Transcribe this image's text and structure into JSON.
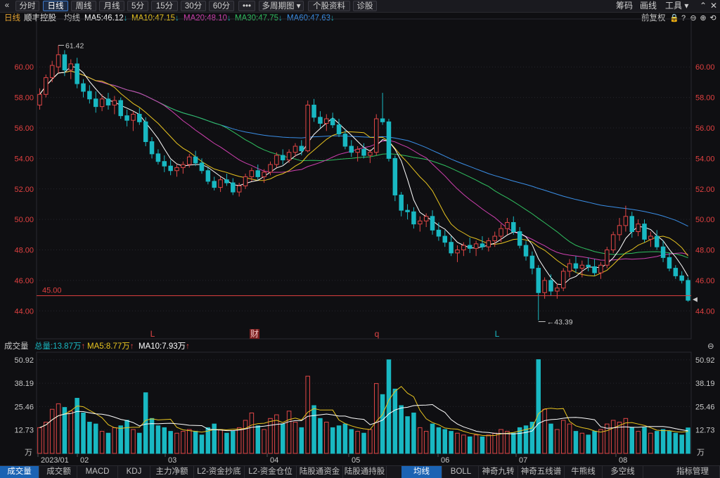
{
  "toolbar": {
    "back_glyph": "«",
    "periods": [
      "分时",
      "日线",
      "周线",
      "月线",
      "5分",
      "15分",
      "30分",
      "60分",
      "•••",
      "多周期图 ▾",
      "个股资料",
      "诊股"
    ],
    "active_index": 1,
    "right": [
      "筹码",
      "画线",
      "工具 ▾"
    ]
  },
  "info": {
    "period": "日线",
    "name": "顺丰控股",
    "label": "均线",
    "ma5": "MA5:46.12",
    "ma10": "MA10:47.15",
    "ma20": "MA20:48.10",
    "ma30": "MA30:47.75",
    "ma60": "MA60:47.63",
    "adjust": "前复权"
  },
  "colors": {
    "up": "#e04646",
    "down": "#19b8c2",
    "ma5": "#ffffff",
    "ma10": "#e8c420",
    "ma20": "#d040b0",
    "ma30": "#30c060",
    "ma60": "#3a8ee6",
    "grid": "#2a2a30",
    "axis": "#e04040"
  },
  "price_axis": {
    "ticks": [
      "60.00",
      "58.00",
      "56.00",
      "54.00",
      "52.00",
      "50.00",
      "48.00",
      "46.00",
      "44.00"
    ],
    "values": [
      60,
      58,
      56,
      54,
      52,
      50,
      48,
      46,
      44
    ]
  },
  "annotations": {
    "high": "61.42",
    "low": "43.39",
    "hline": "45.00",
    "markers": [
      "L",
      "财",
      "q",
      "L"
    ]
  },
  "volume": {
    "title": "成交量",
    "total": "总量:13.87万",
    "ma5": "MA5:8.77万",
    "ma10": "MA10:7.93万",
    "ticks": [
      "50.92",
      "38.19",
      "25.46",
      "12.73",
      "万"
    ],
    "tick_values": [
      50.92,
      38.19,
      25.46,
      12.73
    ]
  },
  "dates": [
    "2023/01",
    "02",
    "03",
    "04",
    "05",
    "06",
    "07",
    "08"
  ],
  "bottom_tabs": [
    "成交量",
    "成交额",
    "MACD",
    "KDJ",
    "主力净额",
    "L2-资金抄底",
    "L2-资金仓位",
    "陆股通资金",
    "陆股通持股",
    "均线",
    "BOLL",
    "神奇九转",
    "神奇五线谱",
    "牛熊线",
    "多空线",
    "指标管理"
  ],
  "bottom_active": [
    0,
    9
  ],
  "chart_data": {
    "type": "candlestick",
    "price_range": [
      43,
      62.5
    ],
    "volume_range": [
      0,
      52
    ],
    "bars": [
      [
        57.5,
        58.6,
        57.2,
        58.2,
        14
      ],
      [
        58.2,
        59.5,
        58,
        59.3,
        17
      ],
      [
        59.3,
        60.4,
        59,
        60.1,
        24
      ],
      [
        60.0,
        61.42,
        59.6,
        60.8,
        27
      ],
      [
        60.8,
        61.1,
        59.4,
        59.8,
        25
      ],
      [
        59.8,
        60.5,
        59.2,
        60.2,
        23
      ],
      [
        60.2,
        60.6,
        58.6,
        58.9,
        30
      ],
      [
        58.9,
        59.2,
        58.0,
        58.4,
        22
      ],
      [
        58.4,
        58.8,
        57.6,
        57.9,
        17
      ],
      [
        57.9,
        58.4,
        57.0,
        57.4,
        16
      ],
      [
        57.4,
        58.2,
        57.1,
        57.9,
        12
      ],
      [
        57.9,
        58.3,
        57.2,
        57.5,
        11
      ],
      [
        57.5,
        58.1,
        56.9,
        57.8,
        14
      ],
      [
        57.8,
        58.0,
        56.6,
        56.8,
        15
      ],
      [
        56.8,
        57.2,
        56.1,
        56.5,
        18
      ],
      [
        56.5,
        57.1,
        55.8,
        56.9,
        13
      ],
      [
        56.9,
        57.3,
        56.2,
        56.4,
        11
      ],
      [
        56.4,
        56.7,
        54.8,
        55.1,
        33
      ],
      [
        55.1,
        55.4,
        54.0,
        54.3,
        19
      ],
      [
        54.3,
        54.6,
        53.6,
        53.8,
        15
      ],
      [
        53.8,
        54.2,
        53.1,
        53.5,
        14
      ],
      [
        53.5,
        53.9,
        52.9,
        53.2,
        12
      ],
      [
        53.2,
        53.6,
        52.8,
        53.4,
        11
      ],
      [
        53.4,
        53.8,
        53.0,
        53.6,
        12
      ],
      [
        53.6,
        54.3,
        53.4,
        54.1,
        13
      ],
      [
        54.1,
        54.5,
        53.5,
        53.7,
        12
      ],
      [
        53.7,
        54.0,
        53.0,
        53.2,
        10
      ],
      [
        53.2,
        53.4,
        52.3,
        52.5,
        14
      ],
      [
        52.5,
        52.8,
        51.9,
        52.1,
        16
      ],
      [
        52.1,
        52.8,
        51.8,
        52.6,
        13
      ],
      [
        52.6,
        53.0,
        52.2,
        52.4,
        11
      ],
      [
        52.4,
        52.7,
        51.6,
        51.8,
        12
      ],
      [
        51.8,
        52.4,
        51.5,
        52.2,
        14
      ],
      [
        52.2,
        53.0,
        52.0,
        52.8,
        18
      ],
      [
        52.8,
        53.4,
        52.5,
        53.2,
        22
      ],
      [
        53.2,
        53.6,
        52.6,
        52.8,
        15
      ],
      [
        52.8,
        53.3,
        52.4,
        53.1,
        13
      ],
      [
        53.1,
        53.8,
        52.9,
        53.6,
        19
      ],
      [
        53.6,
        54.4,
        53.4,
        54.2,
        21
      ],
      [
        54.2,
        54.6,
        53.6,
        53.9,
        16
      ],
      [
        53.9,
        54.6,
        53.7,
        54.4,
        23
      ],
      [
        54.4,
        55.0,
        54.1,
        54.8,
        17
      ],
      [
        54.8,
        55.2,
        54.2,
        54.5,
        14
      ],
      [
        54.5,
        57.8,
        54.4,
        57.5,
        42
      ],
      [
        57.5,
        57.9,
        56.4,
        56.7,
        26
      ],
      [
        56.7,
        57.1,
        56.0,
        56.3,
        19
      ],
      [
        56.3,
        56.9,
        55.8,
        56.6,
        17
      ],
      [
        56.6,
        57.0,
        56.0,
        56.2,
        14
      ],
      [
        56.2,
        56.6,
        55.4,
        55.6,
        15
      ],
      [
        55.6,
        55.9,
        54.6,
        54.8,
        16
      ],
      [
        54.8,
        55.2,
        54.1,
        54.4,
        13
      ],
      [
        54.4,
        54.8,
        53.8,
        54.6,
        12
      ],
      [
        54.6,
        55.0,
        54.0,
        54.2,
        11
      ],
      [
        54.2,
        54.6,
        53.7,
        54.4,
        13
      ],
      [
        54.4,
        56.9,
        54.2,
        56.6,
        38
      ],
      [
        56.6,
        58.3,
        56.2,
        56.4,
        32
      ],
      [
        56.4,
        56.6,
        53.8,
        54.0,
        50.92
      ],
      [
        54.0,
        54.2,
        51.2,
        51.6,
        35
      ],
      [
        51.6,
        51.8,
        50.2,
        50.6,
        26
      ],
      [
        50.6,
        51.0,
        50.0,
        50.5,
        20
      ],
      [
        50.5,
        50.8,
        49.4,
        49.7,
        22
      ],
      [
        49.7,
        50.2,
        49.2,
        49.9,
        14
      ],
      [
        49.9,
        50.4,
        49.5,
        50.2,
        12
      ],
      [
        50.2,
        50.6,
        49.0,
        49.3,
        16
      ],
      [
        49.3,
        49.8,
        48.6,
        48.9,
        14
      ],
      [
        48.9,
        49.3,
        48.2,
        48.5,
        13
      ],
      [
        48.5,
        48.9,
        47.6,
        47.8,
        12
      ],
      [
        47.8,
        48.3,
        47.2,
        48.0,
        11
      ],
      [
        48.0,
        48.5,
        47.6,
        48.3,
        10
      ],
      [
        48.3,
        48.8,
        47.8,
        48.1,
        9
      ],
      [
        48.1,
        48.6,
        47.6,
        48.4,
        10
      ],
      [
        48.4,
        48.9,
        48.0,
        48.2,
        9
      ],
      [
        48.2,
        48.8,
        47.9,
        48.6,
        10
      ],
      [
        48.6,
        49.2,
        48.2,
        48.9,
        11
      ],
      [
        48.9,
        49.7,
        48.5,
        49.4,
        13
      ],
      [
        49.4,
        50.1,
        49.0,
        49.8,
        12
      ],
      [
        49.8,
        50.2,
        49.0,
        49.2,
        11
      ],
      [
        49.2,
        49.5,
        48.1,
        48.3,
        14
      ],
      [
        48.3,
        48.6,
        47.3,
        47.6,
        15
      ],
      [
        47.6,
        47.9,
        46.4,
        46.8,
        17
      ],
      [
        46.8,
        47.0,
        43.39,
        45.2,
        51
      ],
      [
        45.2,
        46.2,
        44.8,
        46.0,
        24
      ],
      [
        46.0,
        46.4,
        45.0,
        45.3,
        16
      ],
      [
        45.3,
        45.8,
        44.8,
        45.5,
        13
      ],
      [
        45.5,
        46.8,
        45.3,
        46.6,
        18
      ],
      [
        46.6,
        47.4,
        46.2,
        47.1,
        16
      ],
      [
        47.1,
        47.6,
        46.5,
        46.8,
        12
      ],
      [
        46.8,
        47.3,
        46.2,
        47.0,
        11
      ],
      [
        47.0,
        47.5,
        46.6,
        46.9,
        10
      ],
      [
        46.9,
        47.4,
        46.3,
        46.5,
        12
      ],
      [
        46.5,
        47.2,
        46.1,
        47.0,
        13
      ],
      [
        47.0,
        48.2,
        46.8,
        48.0,
        16
      ],
      [
        48.0,
        49.2,
        47.8,
        49.0,
        18
      ],
      [
        49.0,
        50.1,
        48.6,
        49.6,
        17
      ],
      [
        49.6,
        50.9,
        49.2,
        50.2,
        19
      ],
      [
        50.2,
        50.5,
        48.8,
        49.2,
        14
      ],
      [
        49.2,
        50.0,
        48.9,
        49.7,
        12
      ],
      [
        49.7,
        50.0,
        48.5,
        48.7,
        14
      ],
      [
        48.7,
        49.2,
        48.2,
        48.9,
        11
      ],
      [
        48.9,
        49.3,
        48.0,
        48.2,
        12
      ],
      [
        48.2,
        48.6,
        47.2,
        47.5,
        13
      ],
      [
        47.5,
        47.8,
        46.6,
        46.8,
        12
      ],
      [
        46.8,
        47.0,
        46.1,
        46.3,
        11
      ],
      [
        46.3,
        46.6,
        45.8,
        46.0,
        10
      ],
      [
        46.0,
        46.2,
        44.6,
        44.7,
        13.87
      ]
    ]
  }
}
